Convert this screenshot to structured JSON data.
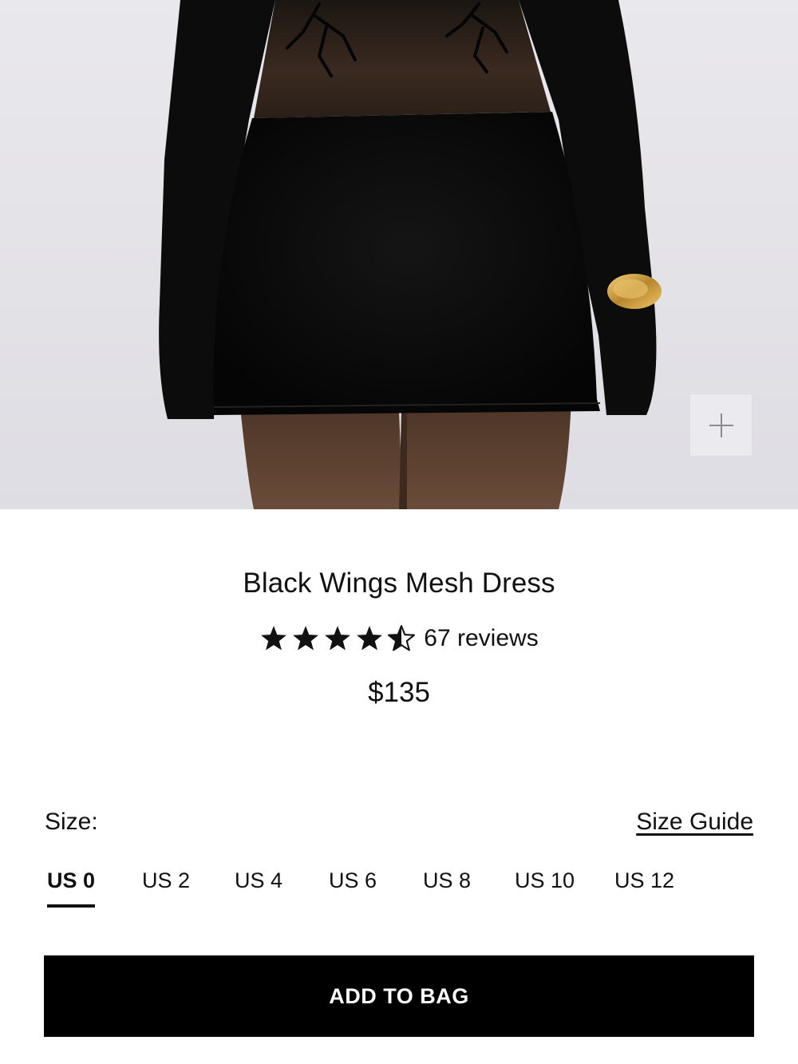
{
  "product": {
    "image_alt": "Black Wings Mesh Dress product photo",
    "title": "Black Wings Mesh Dress",
    "rating": 4.5,
    "rating_max": 5,
    "reviews_text": "67 reviews",
    "price": "$135"
  },
  "size": {
    "label": "Size:",
    "guide_label": "Size Guide",
    "selected": "US 0",
    "options": [
      "US 0",
      "US 2",
      "US 4",
      "US 6",
      "US 8",
      "US 10",
      "US 12"
    ]
  },
  "actions": {
    "add_to_bag": "ADD TO BAG"
  },
  "icons": {
    "zoom": "plus-icon",
    "star": "star-icon",
    "half_star": "star-half-icon"
  },
  "colors": {
    "photo_bg": "#e4e3e8",
    "button_bg": "#000000",
    "button_text": "#ffffff",
    "text": "#111111"
  }
}
